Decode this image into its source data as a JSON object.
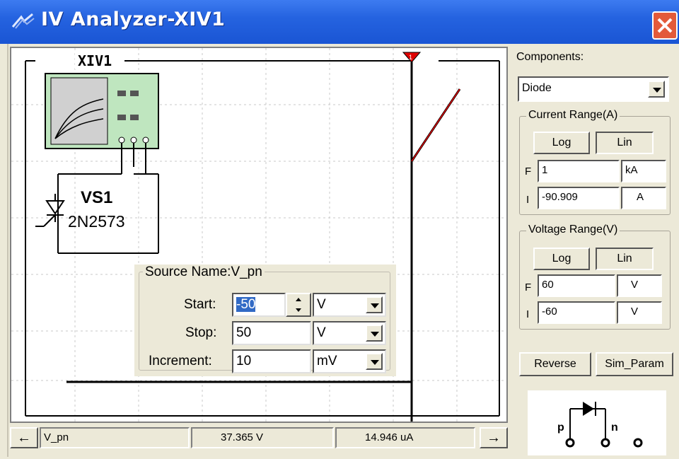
{
  "window": {
    "title": "IV Analyzer-XIV1"
  },
  "schematic": {
    "instrument_label": "XIV1",
    "device_name": "VS1",
    "device_model": "2N2573"
  },
  "source_dialog": {
    "title": "Source Name:V_pn",
    "start_label": "Start:",
    "start_value": "-50",
    "start_unit": "V",
    "stop_label": "Stop:",
    "stop_value": "50",
    "stop_unit": "V",
    "increment_label": "Increment:",
    "increment_value": "10",
    "increment_unit": "mV"
  },
  "status_bar": {
    "left_arrow": "←",
    "variable": "V_pn",
    "voltage": "37.365  V",
    "current": "14.946 uA",
    "right_arrow": "→"
  },
  "side_panel": {
    "components_label": "Components:",
    "component_value": "Diode",
    "current_range": {
      "title": "Current Range(A)",
      "log_label": "Log",
      "lin_label": "Lin",
      "f_label": "F",
      "f_value": "1",
      "f_unit": "kA",
      "i_label": "I",
      "i_value": "-90.909",
      "i_unit": "A"
    },
    "voltage_range": {
      "title": "Voltage Range(V)",
      "log_label": "Log",
      "lin_label": "Lin",
      "f_label": "F",
      "f_value": "60",
      "f_unit": "V",
      "i_label": "I",
      "i_value": "-60",
      "i_unit": "V"
    },
    "reverse_label": "Reverse",
    "sim_param_label": "Sim_Param",
    "pin_labels": {
      "p": "p",
      "n": "n"
    }
  },
  "colors": {
    "curve": "#e00000",
    "titlebar": "#2563e0",
    "cursor": "#e00000"
  }
}
